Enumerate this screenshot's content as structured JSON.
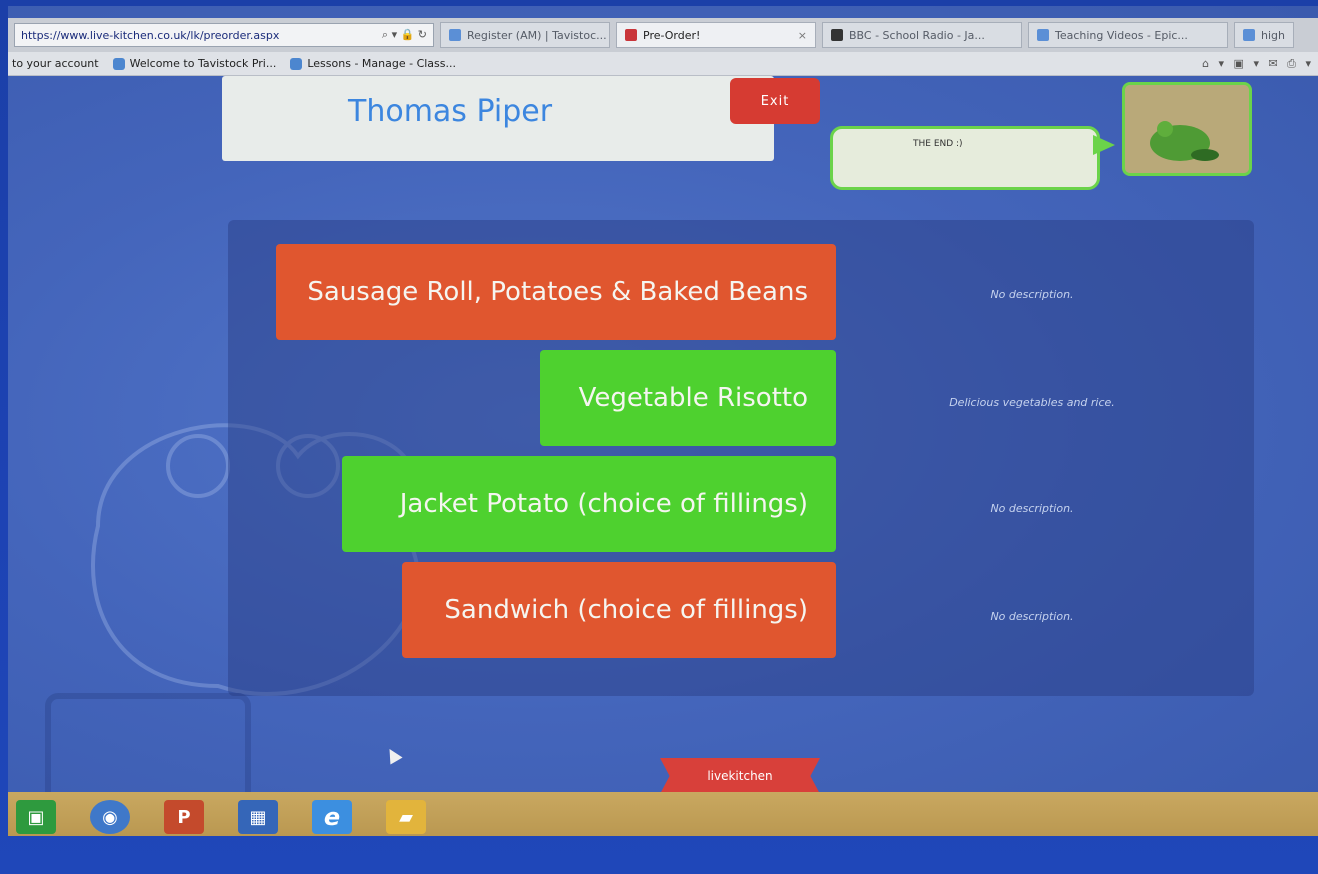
{
  "browser": {
    "url": "https://www.live-kitchen.co.uk/lk/preorder.aspx",
    "address_controls": "⌕ ▾ 🔒 ↻",
    "tabs": [
      {
        "label": "Register (AM) | Tavistoc...",
        "active": false
      },
      {
        "label": "Pre-Order!",
        "active": true
      },
      {
        "label": "BBC - School Radio - Ja...",
        "active": false
      },
      {
        "label": "Teaching Videos - Epic...",
        "active": false
      },
      {
        "label": "high",
        "active": false
      }
    ],
    "close_glyph": "×",
    "favorites": [
      {
        "label": "to your account"
      },
      {
        "label": "Welcome to Tavistock Pri..."
      },
      {
        "label": "Lessons - Manage - Class..."
      }
    ],
    "tools": "⌂ ▾ ▣ ▾ ✉ ⎙ ▾"
  },
  "page": {
    "student_name": "Thomas Piper",
    "exit_label": "Exit",
    "speech_text": "THE END :)",
    "meals": [
      {
        "label": "Sausage Roll, Potatoes & Baked Beans",
        "description": "No description.",
        "color": "#e0562f"
      },
      {
        "label": "Vegetable Risotto",
        "description": "Delicious vegetables and rice.",
        "color": "#4ed12f"
      },
      {
        "label": "Jacket Potato (choice of fillings)",
        "description": "No description.",
        "color": "#4ed12f"
      },
      {
        "label": "Sandwich (choice of fillings)",
        "description": "No description.",
        "color": "#e0562f"
      }
    ],
    "footer_logo": "livekitchen"
  },
  "taskbar": {
    "icons": [
      {
        "name": "store-icon",
        "glyph": "▣",
        "color": "#2e9a3e"
      },
      {
        "name": "chrome-icon",
        "glyph": "◉",
        "color": "#3f78c9"
      },
      {
        "name": "powerpoint-icon",
        "glyph": "P",
        "color": "#c44a2c"
      },
      {
        "name": "smartboard-icon",
        "glyph": "▦",
        "color": "#3566b8"
      },
      {
        "name": "internet-explorer-icon",
        "glyph": "e",
        "color": "#3c8fe0"
      },
      {
        "name": "file-explorer-icon",
        "glyph": "▰",
        "color": "#e2b43c"
      }
    ]
  }
}
